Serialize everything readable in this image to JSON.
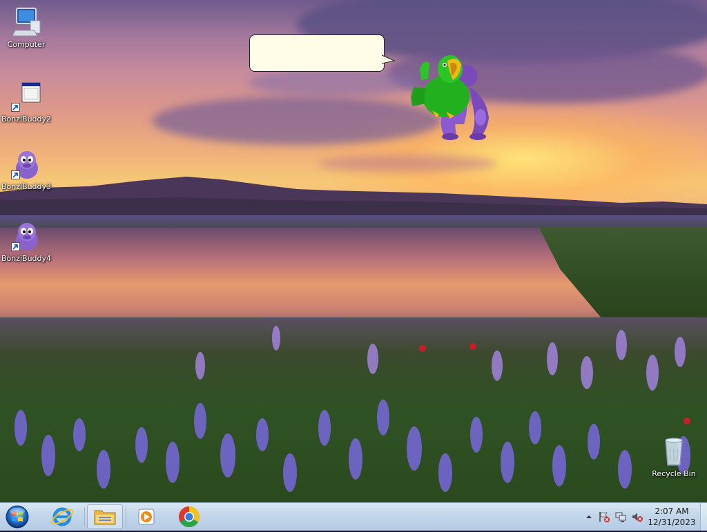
{
  "desktop": {
    "icons": [
      {
        "label": "Computer",
        "icon": "computer-icon"
      },
      {
        "label": "BonziBuddy2",
        "icon": "program-window-icon"
      },
      {
        "label": "BonziBuddy3",
        "icon": "bonzi-purple-icon"
      },
      {
        "label": "BonziBuddy4",
        "icon": "bonzi-purple-icon"
      },
      {
        "label": "Recycle Bin",
        "icon": "recycle-bin-icon"
      }
    ],
    "agent": {
      "balloon_text": "",
      "character": "green-parrot-on-purple-gorilla"
    }
  },
  "taskbar": {
    "start_icon": "windows-orb-icon",
    "pinned": [
      {
        "name": "internet-explorer",
        "icon": "internet-explorer-icon"
      },
      {
        "name": "file-explorer",
        "icon": "folder-icon"
      },
      {
        "name": "media-player",
        "icon": "media-player-icon"
      },
      {
        "name": "chrome",
        "icon": "chrome-icon"
      }
    ],
    "tray": {
      "icons": [
        "show-hidden-icons-icon",
        "action-center-flag-icon",
        "network-icon",
        "volume-muted-icon"
      ],
      "time": "2:07 AM",
      "date": "12/31/2023"
    }
  },
  "colors": {
    "taskbar_top": "#d8e6f3",
    "taskbar_bottom": "#b5cce4",
    "balloon_fill": "#fffde8",
    "parrot_green": "#22b01e",
    "gorilla_purple": "#8a5ad0"
  }
}
